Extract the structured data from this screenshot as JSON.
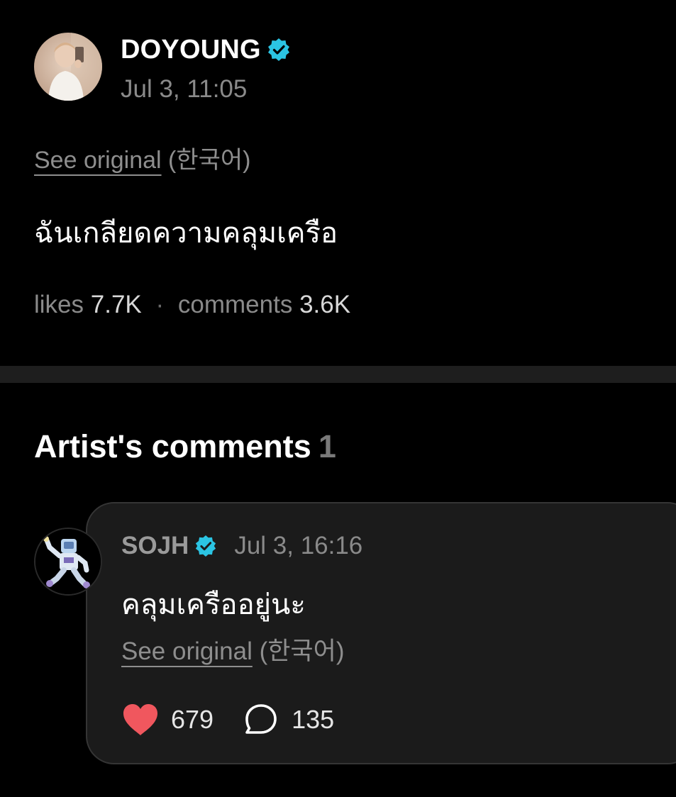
{
  "post": {
    "author": "DOYOUNG",
    "date": "Jul 3, 11:05",
    "verified_icon": "verified-badge-icon",
    "verified_color": "#2bc4e3",
    "see_original_label": "See original",
    "original_language": "(한국어)",
    "body": "ฉันเกลียดความคลุมเครือ",
    "likes_label": "likes",
    "likes_value": "7.7K",
    "separator": "·",
    "comments_label": "comments",
    "comments_value": "3.6K"
  },
  "artist_comments": {
    "title": "Artist's comments",
    "count": "1",
    "items": [
      {
        "author": "SOJH",
        "date": "Jul 3, 16:16",
        "text": "คลุมเครืออยู่นะ",
        "see_original_label": "See original",
        "original_language": "(한국어)",
        "likes": "679",
        "replies": "135",
        "like_icon": "heart-icon",
        "like_color": "#f0575e",
        "reply_icon": "comment-bubble-icon"
      }
    ]
  }
}
